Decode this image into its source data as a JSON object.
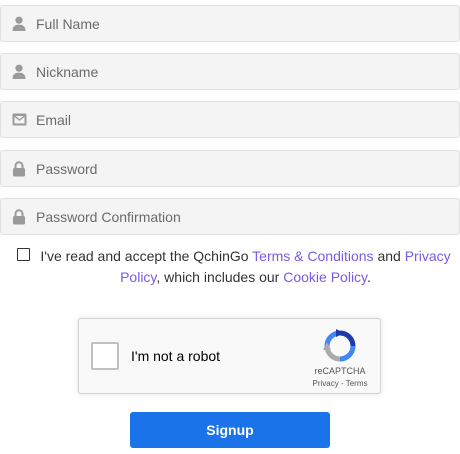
{
  "form": {
    "fields": [
      {
        "placeholder": "Full Name",
        "icon": "user-icon"
      },
      {
        "placeholder": "Nickname",
        "icon": "user-icon"
      },
      {
        "placeholder": "Email",
        "icon": "envelope-icon"
      },
      {
        "placeholder": "Password",
        "icon": "lock-icon"
      },
      {
        "placeholder": "Password Confirmation",
        "icon": "lock-icon"
      }
    ],
    "terms": {
      "prefix": "I've read and accept the QchinGo ",
      "terms_link": "Terms & Conditions",
      "and": " and ",
      "privacy_link": "Privacy Policy",
      "middle": ", which includes our ",
      "cookie_link": "Cookie Policy",
      "suffix": "."
    },
    "recaptcha": {
      "label": "I'm not a robot",
      "brand": "reCAPTCHA",
      "links": "Privacy - Terms"
    },
    "submit_label": "Signup"
  },
  "colors": {
    "link": "#7a5be0",
    "button": "#1a73e8",
    "field_bg": "#f4f4f4"
  }
}
